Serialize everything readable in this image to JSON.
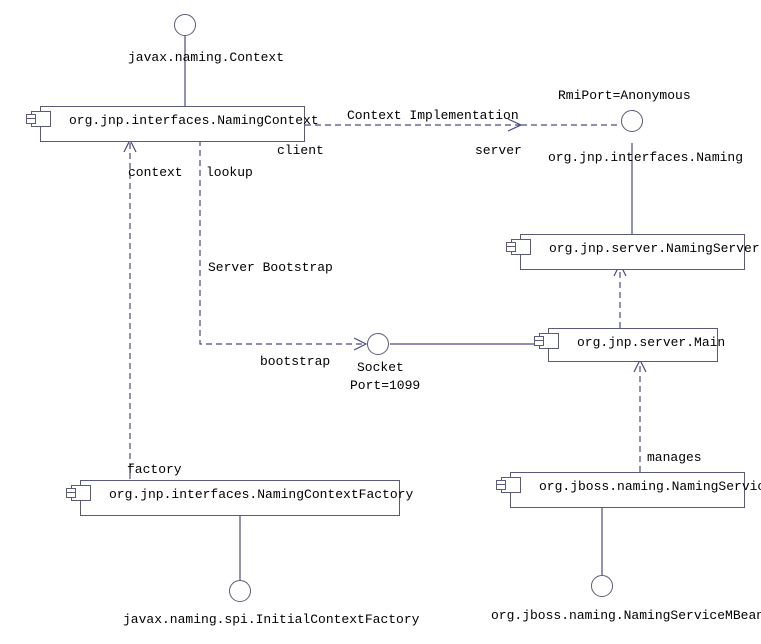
{
  "diagram": {
    "interfaces": {
      "context": {
        "label": "javax.naming.Context"
      },
      "naming": {
        "label": "org.jnp.interfaces.Naming",
        "port_label": "RmiPort=Anonymous"
      },
      "socket": {
        "label": "Socket",
        "port_label": "Port=1099"
      },
      "icf": {
        "label": "javax.naming.spi.InitialContextFactory"
      },
      "mbean": {
        "label": "org.jboss.naming.NamingServiceMBean"
      }
    },
    "components": {
      "naming_context": {
        "label": "org.jnp.interfaces.NamingContext"
      },
      "naming_server": {
        "label": "org.jnp.server.NamingServer"
      },
      "main": {
        "label": "org.jnp.server.Main"
      },
      "ncf": {
        "label": "org.jnp.interfaces.NamingContextFactory"
      },
      "naming_service": {
        "label": "org.jboss.naming.NamingService"
      }
    },
    "connections": {
      "context_impl": {
        "label": "Context Implementation",
        "role_left": "client",
        "role_right": "server"
      },
      "lookup": {
        "label": "lookup"
      },
      "context_role": {
        "label": "context"
      },
      "server_bootstrap": {
        "label": "Server Bootstrap"
      },
      "bootstrap_role": {
        "label": "bootstrap"
      },
      "factory_role": {
        "label": "factory"
      },
      "manages": {
        "label": "manages"
      }
    }
  }
}
